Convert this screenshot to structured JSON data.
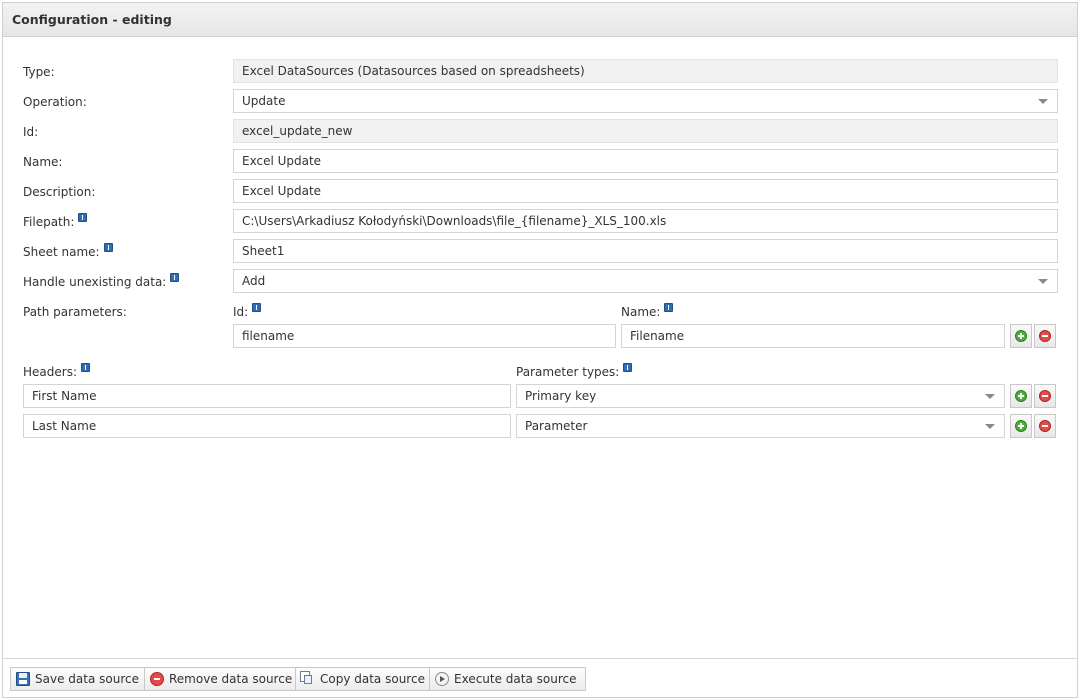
{
  "header": {
    "title": "Configuration - editing"
  },
  "form": {
    "type": {
      "label": "Type:",
      "value": "Excel DataSources (Datasources based on spreadsheets)"
    },
    "operation": {
      "label": "Operation:",
      "value": "Update"
    },
    "id": {
      "label": "Id:",
      "value": "excel_update_new"
    },
    "name": {
      "label": "Name:",
      "value": "Excel Update"
    },
    "description": {
      "label": "Description:",
      "value": "Excel Update"
    },
    "filepath": {
      "label": "Filepath:",
      "value": "C:\\Users\\Arkadiusz Kołodyński\\Downloads\\file_{filename}_XLS_100.xls",
      "info_icon": "info-icon"
    },
    "sheet_name": {
      "label": "Sheet name:",
      "value": "Sheet1",
      "info_icon": "info-icon"
    },
    "handle_unexisting": {
      "label": "Handle unexisting data:",
      "value": "Add",
      "info_icon": "info-icon"
    },
    "path_parameters": {
      "label": "Path parameters:",
      "id_label": "Id:",
      "name_label": "Name:",
      "rows": [
        {
          "id": "filename",
          "name": "Filename"
        }
      ]
    },
    "headers": {
      "label": "Headers:",
      "types_label": "Parameter types:",
      "rows": [
        {
          "header": "First Name",
          "type": "Primary key"
        },
        {
          "header": "Last Name",
          "type": "Parameter"
        }
      ]
    }
  },
  "toolbar": {
    "save": "Save data source",
    "remove": "Remove data source",
    "copy": "Copy data source",
    "execute": "Execute data source"
  },
  "colors": {
    "add": "#4caf3a",
    "remove": "#e24b4b",
    "info": "#2f6fb0"
  }
}
